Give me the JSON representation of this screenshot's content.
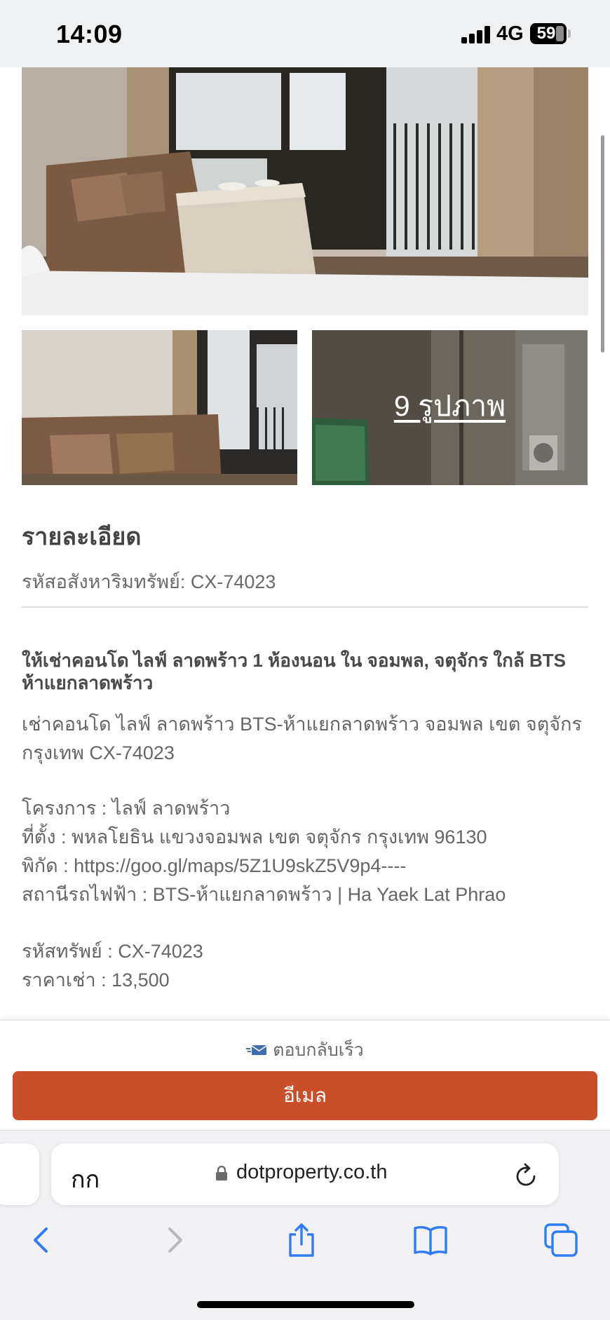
{
  "status_bar": {
    "time": "14:09",
    "network": "4G",
    "battery": "59"
  },
  "gallery": {
    "photo_count_label": "9 รูปภาพ"
  },
  "details": {
    "section_title": "รายละเอียด",
    "reference_line": "รหัสอสังหาริมทรัพย์: CX-74023",
    "listing_title": "ให้เช่าคอนโด ไลฟ์ ลาดพร้าว 1 ห้องนอน ใน จอมพล, จตุจักร ใกล้ BTS ห้าแยกลาดพร้าว",
    "description": "เช่าคอนโด ไลฟ์ ลาดพร้าว BTS-ห้าแยกลาดพร้าว จอมพล เขต จตุจักร กรุงเทพ CX-74023",
    "project": "โครงการ : ไลฟ์ ลาดพร้าว",
    "location": "ที่ตั้ง : พหลโยธิน แขวงจอมพล เขต จตุจักร กรุงเทพ 96130",
    "coordinates": "พิกัด : https://goo.gl/maps/5Z1U9skZ5V9p4----",
    "station": "สถานีรถไฟฟ้า : BTS-ห้าแยกลาดพร้าว | Ha Yaek Lat Phrao",
    "asset_code": "รหัสทรัพย์ : CX-74023",
    "rent_price": "ราคาเช่า : 13,500"
  },
  "contact": {
    "reply_fast_label": "ตอบกลับเร็ว",
    "email_button_label": "อีเมล",
    "button_color": "#c94f2a"
  },
  "browser": {
    "text_size_label": "กก",
    "url": "dotproperty.co.th",
    "icons": [
      "lock-icon",
      "reload-icon",
      "back-icon",
      "forward-icon",
      "share-icon",
      "bookmarks-icon",
      "tabs-icon"
    ],
    "accent_color": "#2f7cf6"
  }
}
